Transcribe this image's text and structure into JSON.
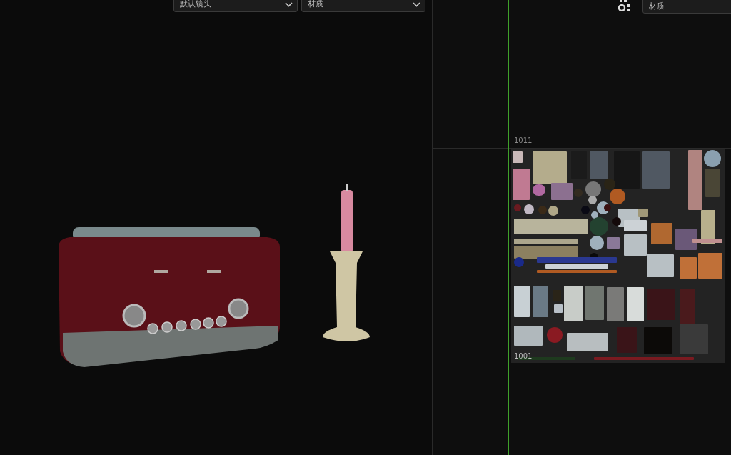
{
  "viewport": {
    "camera_dropdown": {
      "value": "默认镜头"
    },
    "shading_dropdown": {
      "value": "材质"
    }
  },
  "uv_editor": {
    "material_field": {
      "value": "材质"
    },
    "tiles": [
      {
        "label": "1011"
      },
      {
        "label": "1001"
      }
    ]
  }
}
